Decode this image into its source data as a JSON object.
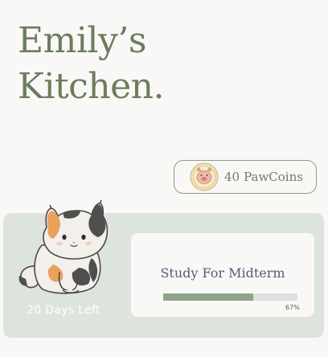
{
  "header": {
    "title_line1": "Emily’s",
    "title_line2": "Kitchen."
  },
  "wallet": {
    "amount": "40",
    "currency": "PawCoins",
    "icon": "pig-coin-icon"
  },
  "task": {
    "days_left": "20 Days Left",
    "title": "Study For Midterm",
    "progress": 0.67,
    "progress_label": "67%",
    "mascot": "calico-cat-illustration"
  },
  "colors": {
    "background": "#faf8f6",
    "accent_green": "#6b7d5e",
    "panel": "#dde3dd",
    "progress_fill": "#8da487",
    "task_text": "#555a78"
  }
}
